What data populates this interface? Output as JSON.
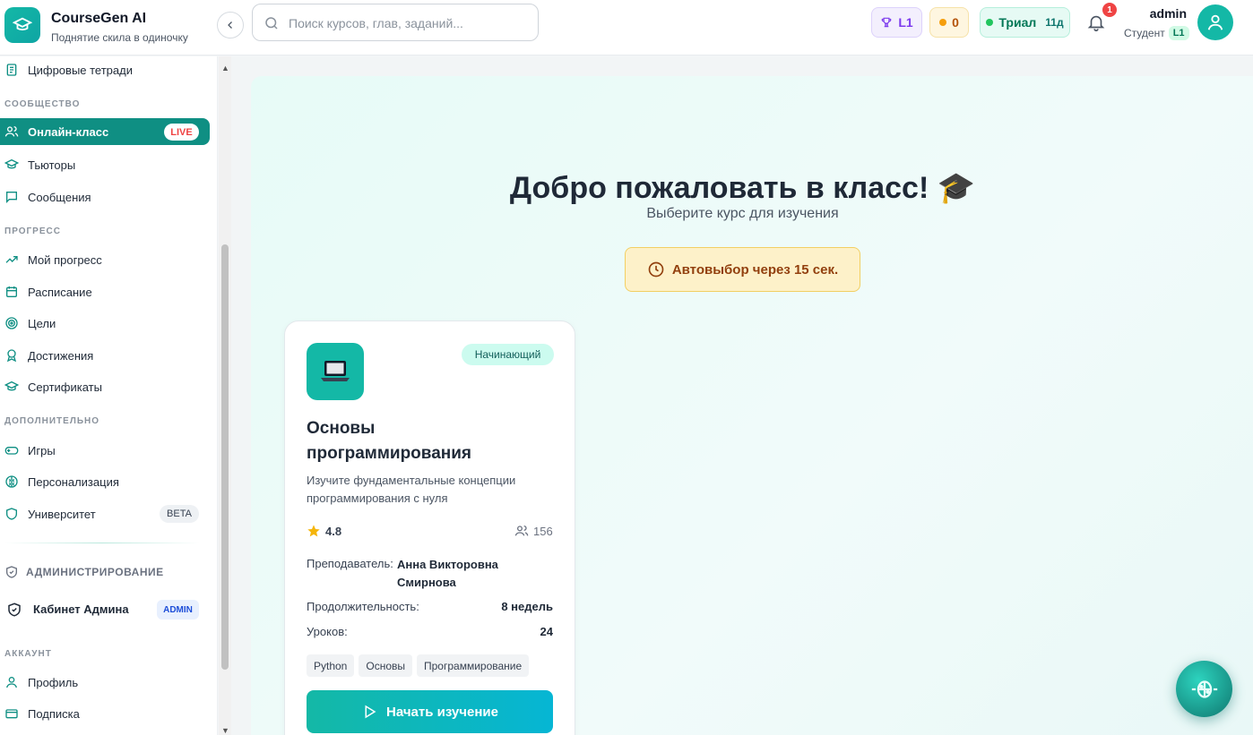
{
  "app": {
    "title": "CourseGen AI",
    "subtitle": "Поднятие скила в одиночку"
  },
  "search": {
    "placeholder": "Поиск курсов, глав, заданий..."
  },
  "header": {
    "level": "L1",
    "coins": "0",
    "trial_label": "Триал",
    "trial_days": "11д",
    "notifications": "1",
    "user_name": "admin",
    "user_role": "Студент",
    "user_level": "L1"
  },
  "sidebar": {
    "top_item": "Цифровые тетради",
    "community_heading": "СООБЩЕСТВО",
    "online_class": "Онлайн-класс",
    "live_badge": "LIVE",
    "tutors": "Тьюторы",
    "messages": "Сообщения",
    "progress_heading": "ПРОГРЕСС",
    "my_progress": "Мой прогресс",
    "schedule": "Расписание",
    "goals": "Цели",
    "achievements": "Достижения",
    "certificates": "Сертификаты",
    "extra_heading": "ДОПОЛНИТЕЛЬНО",
    "games": "Игры",
    "personalization": "Персонализация",
    "university": "Университет",
    "beta_badge": "BETA",
    "admin_heading": "АДМИНИСТРИРОВАНИЕ",
    "admin_cabinet": "Кабинет Админа",
    "admin_badge": "ADMIN",
    "account_heading": "АККАУНТ",
    "profile": "Профиль",
    "subscription": "Подписка"
  },
  "main": {
    "welcome": "Добро пожаловать в класс! 🎓",
    "subtitle": "Выберите курс для изучения",
    "autopick": "Автовыбор через 15 сек."
  },
  "course": {
    "level": "Начинающий",
    "title": "Основы программирования",
    "description": "Изучите фундаментальные концепции программирования с нуля",
    "rating": "4.8",
    "students": "156",
    "teacher_label": "Преподаватель:",
    "teacher_name": "Анна Викторовна Смирнова",
    "duration_label": "Продолжительность:",
    "duration": "8 недель",
    "lessons_label": "Уроков:",
    "lessons": "24",
    "tags": [
      "Python",
      "Основы",
      "Программирование"
    ],
    "start_button": "Начать изучение"
  },
  "colors": {
    "accent": "#0f8f83",
    "brand": "#14b8a6",
    "live": "#ef4444",
    "warning_bg": "#fdf1c9"
  }
}
